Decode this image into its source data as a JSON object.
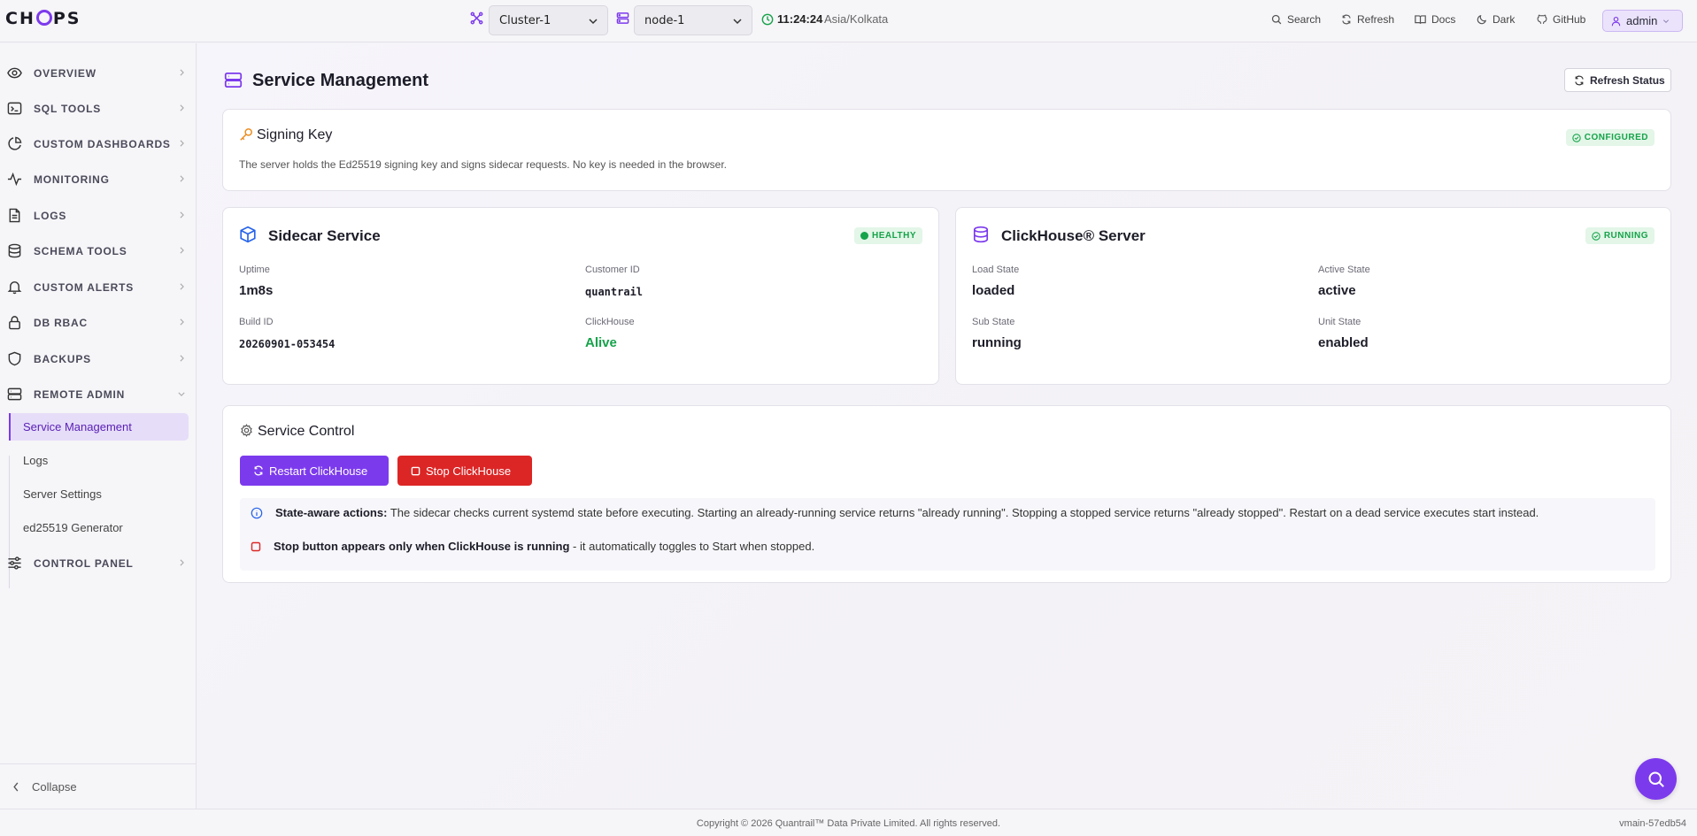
{
  "app": {
    "logo": "CHOPS",
    "logo_icon": "chops-logo"
  },
  "topbar": {
    "cluster": {
      "value": "Cluster-1",
      "icon": "cluster-icon"
    },
    "node": {
      "value": "node-1",
      "icon": "server-icon"
    },
    "time": "11:24:24",
    "timezone": "Asia/Kolkata",
    "links": [
      {
        "label": "Search",
        "icon": "search-icon"
      },
      {
        "label": "Refresh",
        "icon": "refresh-icon"
      },
      {
        "label": "Docs",
        "icon": "book-icon"
      },
      {
        "label": "Dark",
        "icon": "moon-icon"
      },
      {
        "label": "GitHub",
        "icon": "github-icon"
      }
    ],
    "user": "admin"
  },
  "sidebar": {
    "items": [
      {
        "label": "OVERVIEW",
        "icon": "eye-icon"
      },
      {
        "label": "SQL TOOLS",
        "icon": "terminal-icon"
      },
      {
        "label": "CUSTOM DASHBOARDS",
        "icon": "pie-chart-icon"
      },
      {
        "label": "MONITORING",
        "icon": "activity-icon"
      },
      {
        "label": "LOGS",
        "icon": "file-icon"
      },
      {
        "label": "SCHEMA TOOLS",
        "icon": "database-icon"
      },
      {
        "label": "CUSTOM ALERTS",
        "icon": "bell-icon"
      },
      {
        "label": "DB RBAC",
        "icon": "lock-icon"
      },
      {
        "label": "BACKUPS",
        "icon": "shield-icon"
      },
      {
        "label": "REMOTE ADMIN",
        "icon": "server-icon",
        "expanded": true
      }
    ],
    "remote_admin_children": [
      {
        "label": "Service Management",
        "active": true
      },
      {
        "label": "Logs"
      },
      {
        "label": "Server Settings"
      },
      {
        "label": "ed25519 Generator"
      }
    ],
    "control_panel": {
      "label": "CONTROL PANEL",
      "icon": "sliders-icon"
    },
    "collapse": "Collapse"
  },
  "page": {
    "title": "Service Management",
    "refresh_button": "Refresh Status"
  },
  "signing_key": {
    "title": "Signing Key",
    "badge": "CONFIGURED",
    "description": "The server holds the Ed25519 signing key and signs sidecar requests. No key is needed in the browser."
  },
  "sidecar": {
    "title": "Sidecar Service",
    "badge": "HEALTHY",
    "fields": {
      "uptime_label": "Uptime",
      "uptime": "1m8s",
      "customer_label": "Customer ID",
      "customer": "quantrail",
      "build_label": "Build ID",
      "build": "20260901-053454",
      "clickhouse_label": "ClickHouse",
      "clickhouse": "Alive"
    }
  },
  "clickhouse_server": {
    "title": "ClickHouse® Server",
    "badge": "RUNNING",
    "fields": {
      "load_label": "Load State",
      "load": "loaded",
      "active_label": "Active State",
      "active": "active",
      "sub_label": "Sub State",
      "sub": "running",
      "unit_label": "Unit State",
      "unit": "enabled"
    }
  },
  "service_control": {
    "title": "Service Control",
    "restart_button": "Restart ClickHouse",
    "stop_button": "Stop ClickHouse",
    "note1_bold": "State-aware actions:",
    "note1_text": " The sidecar checks current systemd state before executing. Starting an already-running service returns \"already running\". Stopping a stopped service returns \"already stopped\". Restart on a dead service executes start instead.",
    "note2_bold": "Stop button appears only when ClickHouse is running",
    "note2_text": " - it automatically toggles to Start when stopped."
  },
  "footer": {
    "copyright": "Copyright © 2026 Quantrail™ Data Private Limited. All rights reserved.",
    "version": "vmain-57edb54"
  },
  "colors": {
    "accent": "#7c3aed",
    "success": "#16a34a",
    "danger": "#dc2626"
  }
}
